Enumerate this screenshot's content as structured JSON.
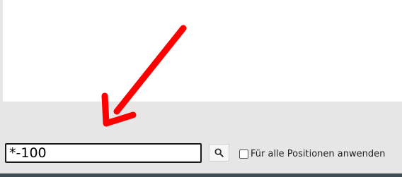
{
  "search": {
    "value": "*-100",
    "button_icon": "search-icon"
  },
  "apply_all": {
    "label": "Für alle Positionen anwenden",
    "checked": false
  },
  "annotation": {
    "icon": "arrow-pointing-down-left-icon",
    "color": "#ff0000"
  },
  "colors": {
    "panel": "#ffffff",
    "toolbar": "#e6e6e6",
    "bottom_strip": "#3f4f55"
  }
}
